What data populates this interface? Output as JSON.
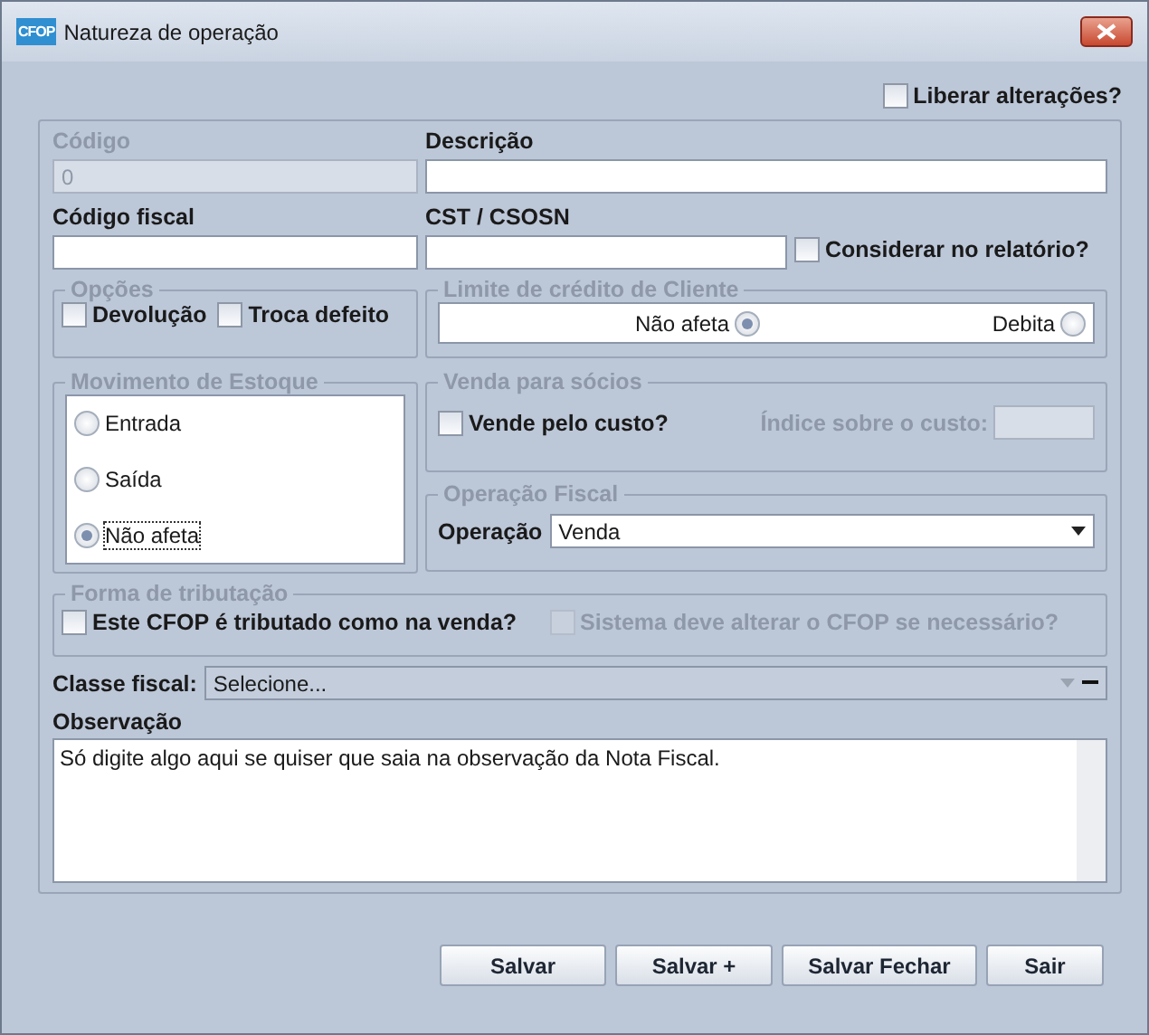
{
  "window": {
    "title": "Natureza de operação",
    "logo": "CFOP"
  },
  "liberar": {
    "label": "Liberar alterações?",
    "checked": false
  },
  "codigo": {
    "label": "Código",
    "value": "0",
    "disabled": true
  },
  "descricao": {
    "label": "Descrição"
  },
  "codigo_fiscal": {
    "label": "Código fiscal"
  },
  "cst": {
    "label": "CST / CSOSN"
  },
  "considerar": {
    "label": "Considerar no relatório?",
    "checked": false
  },
  "opcoes": {
    "title": "Opções",
    "checkboxes": [
      {
        "label": "Devolução",
        "checked": false
      },
      {
        "label": "Troca defeito",
        "checked": false
      }
    ]
  },
  "limite_credito": {
    "title": "Limite de crédito de Cliente",
    "options": [
      {
        "label": "Não afeta",
        "selected": true
      },
      {
        "label": "Debita",
        "selected": false
      }
    ]
  },
  "movimento_estoque": {
    "title": "Movimento de Estoque",
    "options": [
      {
        "label": "Entrada",
        "selected": false
      },
      {
        "label": "Saída",
        "selected": false
      },
      {
        "label": "Não afeta",
        "selected": true
      }
    ]
  },
  "venda_socios": {
    "title": "Venda para sócios",
    "checkbox": {
      "label": "Vende pelo custo?",
      "checked": false
    },
    "indice_label": "Índice sobre o custo:"
  },
  "operacao_fiscal": {
    "title": "Operação Fiscal",
    "label": "Operação",
    "value": "Venda"
  },
  "forma_tributacao": {
    "title": "Forma de tributação",
    "checkboxes": [
      {
        "label": "Este CFOP é tributado como na venda?",
        "checked": false,
        "disabled": false
      },
      {
        "label": "Sistema deve alterar o CFOP se necessário?",
        "checked": false,
        "disabled": true
      }
    ]
  },
  "classe_fiscal": {
    "label": "Classe fiscal:",
    "placeholder": "Selecione..."
  },
  "observacao": {
    "label": "Observação",
    "value": "Só digite algo aqui se quiser que saia na observação da Nota Fiscal."
  },
  "buttons": [
    "Salvar",
    "Salvar +",
    "Salvar Fechar",
    "Sair"
  ]
}
